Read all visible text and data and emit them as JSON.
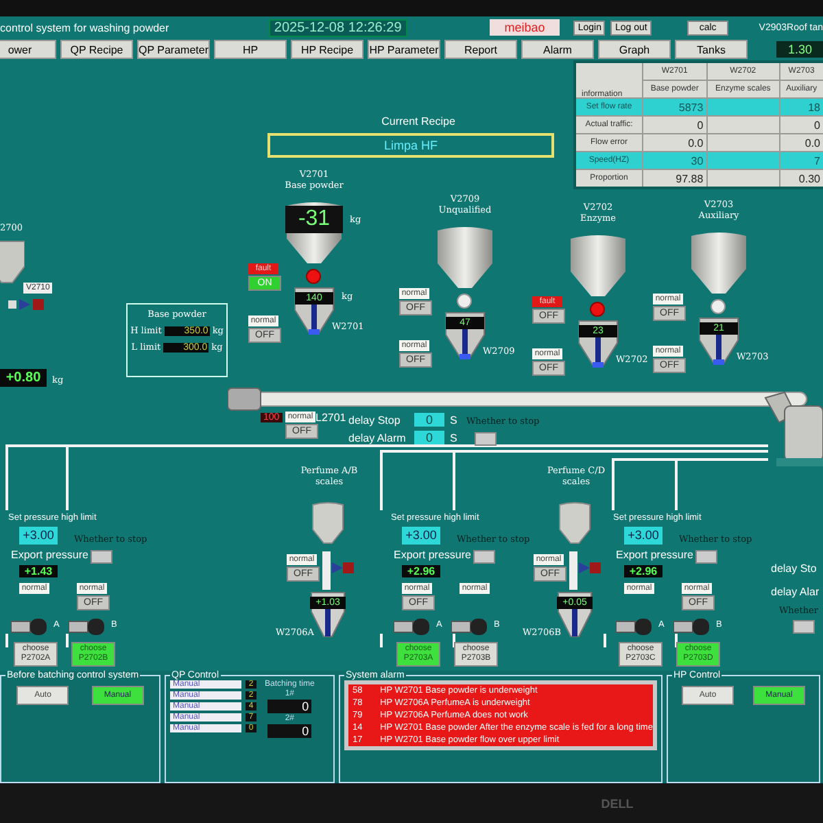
{
  "header": {
    "title": "control system for washing powder",
    "datetime": "2025-12-08  12:26:29",
    "user": "meibao",
    "buttons": [
      "Login",
      "Log out"
    ],
    "calc": "calc",
    "tag": "V2903Roof tan",
    "tag_value": "1.30"
  },
  "nav": [
    "ower",
    "QP Recipe",
    "QP Parameter",
    "HP",
    "HP Recipe",
    "HP Parameter",
    "Report",
    "Alarm",
    "Graph",
    "Tanks"
  ],
  "recipe": {
    "label": "Current Recipe",
    "value": "Limpa HF"
  },
  "flow_table": {
    "corner": "information",
    "columns": [
      {
        "code": "W2701",
        "name": "Base powder"
      },
      {
        "code": "W2702",
        "name": "Enzyme scales"
      },
      {
        "code": "W2703",
        "name": "Auxiliary"
      }
    ],
    "rows": [
      {
        "label": "Set flow rate",
        "highlight": true,
        "cells": [
          "5873",
          "",
          "18"
        ]
      },
      {
        "label": "Actual traffic:",
        "highlight": false,
        "cells": [
          "0",
          "",
          "0"
        ]
      },
      {
        "label": "Flow error",
        "highlight": false,
        "cells": [
          "0.0",
          "",
          "0.0"
        ]
      },
      {
        "label": "Speed(HZ)",
        "highlight": true,
        "cells": [
          "30",
          "",
          "7"
        ]
      },
      {
        "label": "Proportion",
        "highlight": false,
        "cells": [
          "97.88",
          "",
          "0.30"
        ]
      }
    ]
  },
  "feeder": {
    "code": "2700",
    "valve": "V2710",
    "reading": "+0.80",
    "unit": "kg"
  },
  "scales": [
    {
      "code": "V2701",
      "name": "Base powder",
      "reading": "-31",
      "unit": "kg",
      "weigher": "140",
      "weigher_unit": "kg",
      "tag": "W2701",
      "valve_alarm": true,
      "switches": [
        {
          "status": "fault",
          "state": "ON",
          "fault": true,
          "on": true
        },
        {
          "status": "normal",
          "state": "OFF",
          "fault": false,
          "on": false
        }
      ]
    },
    {
      "code": "V2709",
      "name": "Unqualified",
      "weigher": "47",
      "tag": "W2709",
      "valve_alarm": false,
      "switches": [
        {
          "status": "normal",
          "state": "OFF",
          "fault": false,
          "on": false
        },
        {
          "status": "normal",
          "state": "OFF",
          "fault": false,
          "on": false
        }
      ]
    },
    {
      "code": "V2702",
      "name": "Enzyme",
      "weigher": "23",
      "tag": "W2702",
      "valve_alarm": true,
      "switches": [
        {
          "status": "fault",
          "state": "OFF",
          "fault": true,
          "on": false
        },
        {
          "status": "normal",
          "state": "OFF",
          "fault": false,
          "on": false
        }
      ]
    },
    {
      "code": "V2703",
      "name": "Auxiliary",
      "weigher": "21",
      "tag": "W2703",
      "valve_alarm": false,
      "switches": [
        {
          "status": "normal",
          "state": "OFF",
          "fault": false,
          "on": false
        },
        {
          "status": "normal",
          "state": "OFF",
          "fault": false,
          "on": false
        }
      ]
    }
  ],
  "limits": {
    "title": "Base powder",
    "rows": [
      {
        "label": "H limit",
        "value": "350.0",
        "unit": "kg"
      },
      {
        "label": "L limit",
        "value": "300.0",
        "unit": "kg"
      }
    ]
  },
  "conveyor": {
    "tag": "L2701",
    "speed": "100",
    "switch": {
      "status": "normal",
      "state": "OFF",
      "fault": false,
      "on": false
    }
  },
  "delays": {
    "items": [
      {
        "label": "delay Stop",
        "value": "0",
        "unit": "S"
      },
      {
        "label": "delay Alarm",
        "value": "0",
        "unit": "S"
      }
    ],
    "stop_label": "Whether to stop",
    "stop_on": false
  },
  "pump_groups": [
    {
      "limit_label": "Set pressure high limit",
      "limit": "+3.00",
      "pressure_label": "Export pressure",
      "pressure": "+1.43",
      "stop_label": "Whether to stop",
      "stop_on": false,
      "pumps": [
        {
          "letter": "A",
          "status": "normal",
          "choose": "choose",
          "code": "P2702A",
          "selected": false
        },
        {
          "letter": "B",
          "status": "normal",
          "state": "OFF",
          "choose": "choose",
          "code": "P2702B",
          "selected": true
        }
      ]
    },
    {
      "limit_label": "Set pressure high limit",
      "limit": "+3.00",
      "pressure_label": "Export pressure",
      "pressure": "+2.96",
      "stop_label": "Whether to stop",
      "stop_on": false,
      "pumps": [
        {
          "letter": "A",
          "status": "normal",
          "state": "OFF",
          "choose": "choose",
          "code": "P2703A",
          "selected": true
        },
        {
          "letter": "B",
          "status": "normal",
          "choose": "choose",
          "code": "P2703B",
          "selected": false
        }
      ]
    },
    {
      "limit_label": "Set pressure high limit",
      "limit": "+3.00",
      "pressure_label": "Export pressure",
      "pressure": "+2.96",
      "stop_label": "Whether to stop",
      "stop_on": false,
      "pumps": [
        {
          "letter": "A",
          "status": "normal",
          "choose": "choose",
          "code": "P2703C",
          "selected": false
        },
        {
          "letter": "B",
          "status": "normal",
          "state": "OFF",
          "choose": "choose",
          "code": "P2703D",
          "selected": true
        }
      ]
    }
  ],
  "perfume_scales": [
    {
      "title": "Perfume A/B",
      "subtitle": "scales",
      "reading": "+1.03",
      "tag": "W2706A",
      "status": "normal",
      "state": "OFF"
    },
    {
      "title": "Perfume C/D",
      "subtitle": "scales",
      "reading": "+0.05",
      "tag": "W2706B",
      "status": "normal",
      "state": "OFF"
    }
  ],
  "right_delays": {
    "items": [
      "delay Sto",
      "delay Alar"
    ],
    "stop_label": "Whether",
    "stop_on": false
  },
  "before_batching": {
    "title": "Before batching control system",
    "modes": [
      {
        "label": "Auto",
        "selected": false
      },
      {
        "label": "Manual",
        "selected": true
      }
    ]
  },
  "qp_control": {
    "title": "QP Control",
    "rows": [
      {
        "mode": "Manual",
        "count": "2"
      },
      {
        "mode": "Manual",
        "count": "2"
      },
      {
        "mode": "Manual",
        "count": "4"
      },
      {
        "mode": "Manual",
        "count": "7"
      },
      {
        "mode": "Manual",
        "count": "0"
      }
    ],
    "batching_label": "Batching time",
    "timers": [
      {
        "label": "1#",
        "value": "0"
      },
      {
        "label": "2#",
        "value": "0"
      }
    ]
  },
  "system_alarm": {
    "title": "System alarm",
    "rows": [
      {
        "code": "58",
        "text": "HP W2701 Base powder is underweight"
      },
      {
        "code": "78",
        "text": "HP W2706A PerfumeA is underweight"
      },
      {
        "code": "79",
        "text": "HP W2706A PerfumeA does not work"
      },
      {
        "code": "14",
        "text": "HP W2701 Base powder After the enzyme scale  is fed for a long time"
      },
      {
        "code": "17",
        "text": "HP W2701 Base powder flow over upper limit"
      }
    ]
  },
  "hp_control": {
    "title": "HP Control",
    "modes": [
      {
        "label": "Auto",
        "selected": false
      },
      {
        "label": "Manual",
        "selected": true
      }
    ]
  },
  "bezel_logo": "DELL"
}
